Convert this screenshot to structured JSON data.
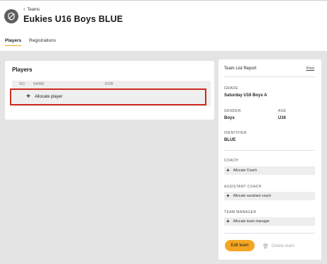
{
  "header": {
    "back_label": "Teams",
    "title": "Eukies U16 Boys BLUE"
  },
  "tabs": [
    {
      "label": "Players",
      "active": true
    },
    {
      "label": "Registrations",
      "active": false
    }
  ],
  "players": {
    "heading": "Players",
    "columns": [
      "NO",
      "NAME",
      "DOB"
    ],
    "allocate_label": "Allocate player"
  },
  "team_report": {
    "title": "Team List Report",
    "print_label": "Print",
    "grade_label": "GRADE",
    "grade_value": "Saturday U16 Boys A",
    "gender_label": "GENDER",
    "gender_value": "Boys",
    "age_label": "AGE",
    "age_value": "U16",
    "identifier_label": "IDENTIFIER",
    "identifier_value": "BLUE",
    "coach_label": "COACH",
    "coach_allocate": "Allocate Coach",
    "assistant_label": "ASSISTANT COACH",
    "assistant_allocate": "Allocate assistant coach",
    "manager_label": "TEAM MANAGER",
    "manager_allocate": "Allocate team manager",
    "edit_label": "Edit team",
    "delete_label": "Delete team"
  },
  "colors": {
    "accent": "#f5a623",
    "highlight": "#d0281f",
    "background": "#e4e4e4"
  }
}
